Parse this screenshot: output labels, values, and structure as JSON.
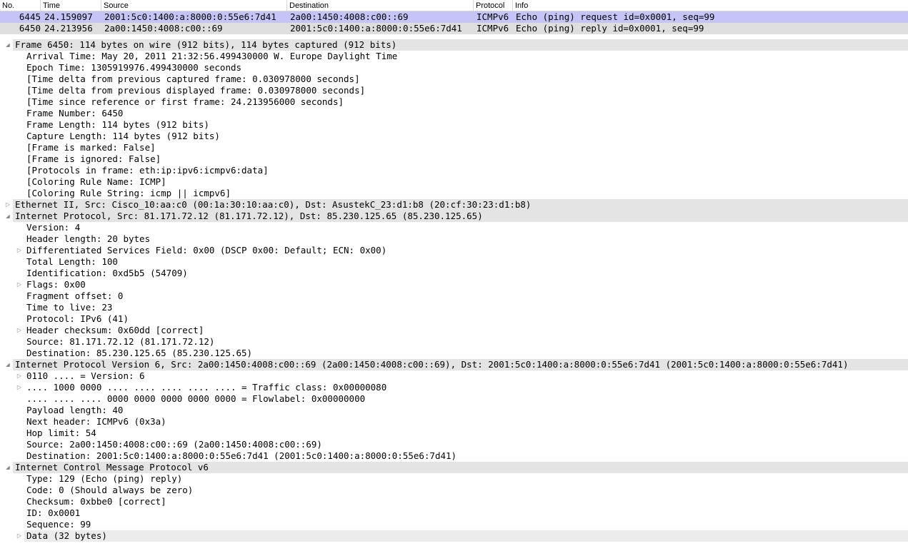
{
  "columns": {
    "no": "No.",
    "time": "Time",
    "source": "Source",
    "destination": "Destination",
    "protocol": "Protocol",
    "info": "Info"
  },
  "packets": [
    {
      "no": "6445",
      "time": "24.159097",
      "source": "2001:5c0:1400:a:8000:0:55e6:7d41",
      "destination": "2a00:1450:4008:c00::69",
      "protocol": "ICMPv6",
      "info": "Echo (ping) request id=0x0001, seq=99",
      "selected": true
    },
    {
      "no": "6450",
      "time": "24.213956",
      "source": "2a00:1450:4008:c00::69",
      "destination": "2001:5c0:1400:a:8000:0:55e6:7d41",
      "protocol": "ICMPv6",
      "info": "Echo (ping) reply id=0x0001, seq=99",
      "selected": false
    }
  ],
  "details": [
    {
      "depth": 0,
      "toggle": "expanded",
      "section": true,
      "text": "Frame 6450: 114 bytes on wire (912 bits), 114 bytes captured (912 bits)"
    },
    {
      "depth": 1,
      "toggle": "none",
      "text": "Arrival Time: May 20, 2011 21:32:56.499430000 W. Europe Daylight Time"
    },
    {
      "depth": 1,
      "toggle": "none",
      "text": "Epoch Time: 1305919976.499430000 seconds"
    },
    {
      "depth": 1,
      "toggle": "none",
      "text": "[Time delta from previous captured frame: 0.030978000 seconds]"
    },
    {
      "depth": 1,
      "toggle": "none",
      "text": "[Time delta from previous displayed frame: 0.030978000 seconds]"
    },
    {
      "depth": 1,
      "toggle": "none",
      "text": "[Time since reference or first frame: 24.213956000 seconds]"
    },
    {
      "depth": 1,
      "toggle": "none",
      "text": "Frame Number: 6450"
    },
    {
      "depth": 1,
      "toggle": "none",
      "text": "Frame Length: 114 bytes (912 bits)"
    },
    {
      "depth": 1,
      "toggle": "none",
      "text": "Capture Length: 114 bytes (912 bits)"
    },
    {
      "depth": 1,
      "toggle": "none",
      "text": "[Frame is marked: False]"
    },
    {
      "depth": 1,
      "toggle": "none",
      "text": "[Frame is ignored: False]"
    },
    {
      "depth": 1,
      "toggle": "none",
      "text": "[Protocols in frame: eth:ip:ipv6:icmpv6:data]"
    },
    {
      "depth": 1,
      "toggle": "none",
      "text": "[Coloring Rule Name: ICMP]"
    },
    {
      "depth": 1,
      "toggle": "none",
      "text": "[Coloring Rule String: icmp || icmpv6]"
    },
    {
      "depth": 0,
      "toggle": "collapsed",
      "section": true,
      "text": "Ethernet II, Src: Cisco_10:aa:c0 (00:1a:30:10:aa:c0), Dst: AsustekC_23:d1:b8 (20:cf:30:23:d1:b8)"
    },
    {
      "depth": 0,
      "toggle": "expanded",
      "section": true,
      "text": "Internet Protocol, Src: 81.171.72.12 (81.171.72.12), Dst: 85.230.125.65 (85.230.125.65)"
    },
    {
      "depth": 1,
      "toggle": "none",
      "text": "Version: 4"
    },
    {
      "depth": 1,
      "toggle": "none",
      "text": "Header length: 20 bytes"
    },
    {
      "depth": 1,
      "toggle": "collapsed",
      "text": "Differentiated Services Field: 0x00 (DSCP 0x00: Default; ECN: 0x00)"
    },
    {
      "depth": 1,
      "toggle": "none",
      "text": "Total Length: 100"
    },
    {
      "depth": 1,
      "toggle": "none",
      "text": "Identification: 0xd5b5 (54709)"
    },
    {
      "depth": 1,
      "toggle": "collapsed",
      "text": "Flags: 0x00"
    },
    {
      "depth": 1,
      "toggle": "none",
      "text": "Fragment offset: 0"
    },
    {
      "depth": 1,
      "toggle": "none",
      "text": "Time to live: 23"
    },
    {
      "depth": 1,
      "toggle": "none",
      "text": "Protocol: IPv6 (41)"
    },
    {
      "depth": 1,
      "toggle": "collapsed",
      "text": "Header checksum: 0x60dd [correct]"
    },
    {
      "depth": 1,
      "toggle": "none",
      "text": "Source: 81.171.72.12 (81.171.72.12)"
    },
    {
      "depth": 1,
      "toggle": "none",
      "text": "Destination: 85.230.125.65 (85.230.125.65)"
    },
    {
      "depth": 0,
      "toggle": "expanded",
      "section": true,
      "text": "Internet Protocol Version 6, Src: 2a00:1450:4008:c00::69 (2a00:1450:4008:c00::69), Dst: 2001:5c0:1400:a:8000:0:55e6:7d41 (2001:5c0:1400:a:8000:0:55e6:7d41)"
    },
    {
      "depth": 1,
      "toggle": "collapsed",
      "text": "0110 .... = Version: 6"
    },
    {
      "depth": 1,
      "toggle": "collapsed",
      "text": ".... 1000 0000 .... .... .... .... .... = Traffic class: 0x00000080"
    },
    {
      "depth": 1,
      "toggle": "none",
      "text": ".... .... .... 0000 0000 0000 0000 0000 = Flowlabel: 0x00000000"
    },
    {
      "depth": 1,
      "toggle": "none",
      "text": "Payload length: 40"
    },
    {
      "depth": 1,
      "toggle": "none",
      "text": "Next header: ICMPv6 (0x3a)"
    },
    {
      "depth": 1,
      "toggle": "none",
      "text": "Hop limit: 54"
    },
    {
      "depth": 1,
      "toggle": "none",
      "text": "Source: 2a00:1450:4008:c00::69 (2a00:1450:4008:c00::69)"
    },
    {
      "depth": 1,
      "toggle": "none",
      "text": "Destination: 2001:5c0:1400:a:8000:0:55e6:7d41 (2001:5c0:1400:a:8000:0:55e6:7d41)"
    },
    {
      "depth": 0,
      "toggle": "expanded",
      "section": true,
      "text": "Internet Control Message Protocol v6"
    },
    {
      "depth": 1,
      "toggle": "none",
      "text": "Type: 129 (Echo (ping) reply)"
    },
    {
      "depth": 1,
      "toggle": "none",
      "text": "Code: 0 (Should always be zero)"
    },
    {
      "depth": 1,
      "toggle": "none",
      "text": "Checksum: 0xbbe0 [correct]"
    },
    {
      "depth": 1,
      "toggle": "none",
      "text": "ID: 0x0001"
    },
    {
      "depth": 1,
      "toggle": "none",
      "text": "Sequence: 99"
    },
    {
      "depth": 1,
      "toggle": "collapsed",
      "highlight": true,
      "text": "Data (32 bytes)"
    }
  ],
  "icons": {
    "expanded": "triangle-down-icon",
    "collapsed": "triangle-right-icon"
  },
  "colors": {
    "selected_row": "#c6c3f6",
    "packet_row": "#dedede",
    "section_row": "#e4e4e4"
  }
}
